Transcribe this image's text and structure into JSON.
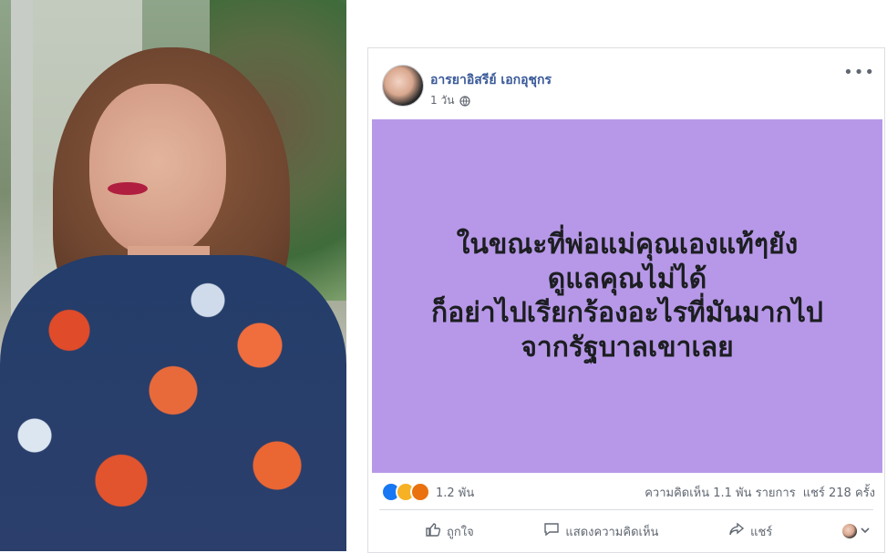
{
  "post": {
    "author": "อารยาอิสรีย์ เอกอุชุกร",
    "time": "1 วัน",
    "more_label": "•••",
    "text_lines": [
      "ในขณะที่พ่อแม่คุณเองแท้ๆยัง",
      "ดูแลคุณไม่ได้",
      "ก็อย่าไปเรียกร้องอะไรที่มันมากไป",
      "จากรัฐบาลเขาเลย"
    ],
    "background_color": "#b798e8"
  },
  "counts": {
    "reactions_total": "1.2 พัน",
    "comments": "ความคิดเห็น 1.1 พัน รายการ",
    "shares": "แชร์ 218 ครั้ง"
  },
  "actions": {
    "like": "ถูกใจ",
    "comment": "แสดงความคิดเห็น",
    "share": "แชร์"
  },
  "icons": {
    "globe": "globe-icon",
    "like": "like-icon",
    "haha": "haha-icon",
    "angry": "angry-icon",
    "comment": "comment-icon",
    "share": "share-icon",
    "more": "more-icon",
    "chevron": "chevron-down-icon"
  }
}
